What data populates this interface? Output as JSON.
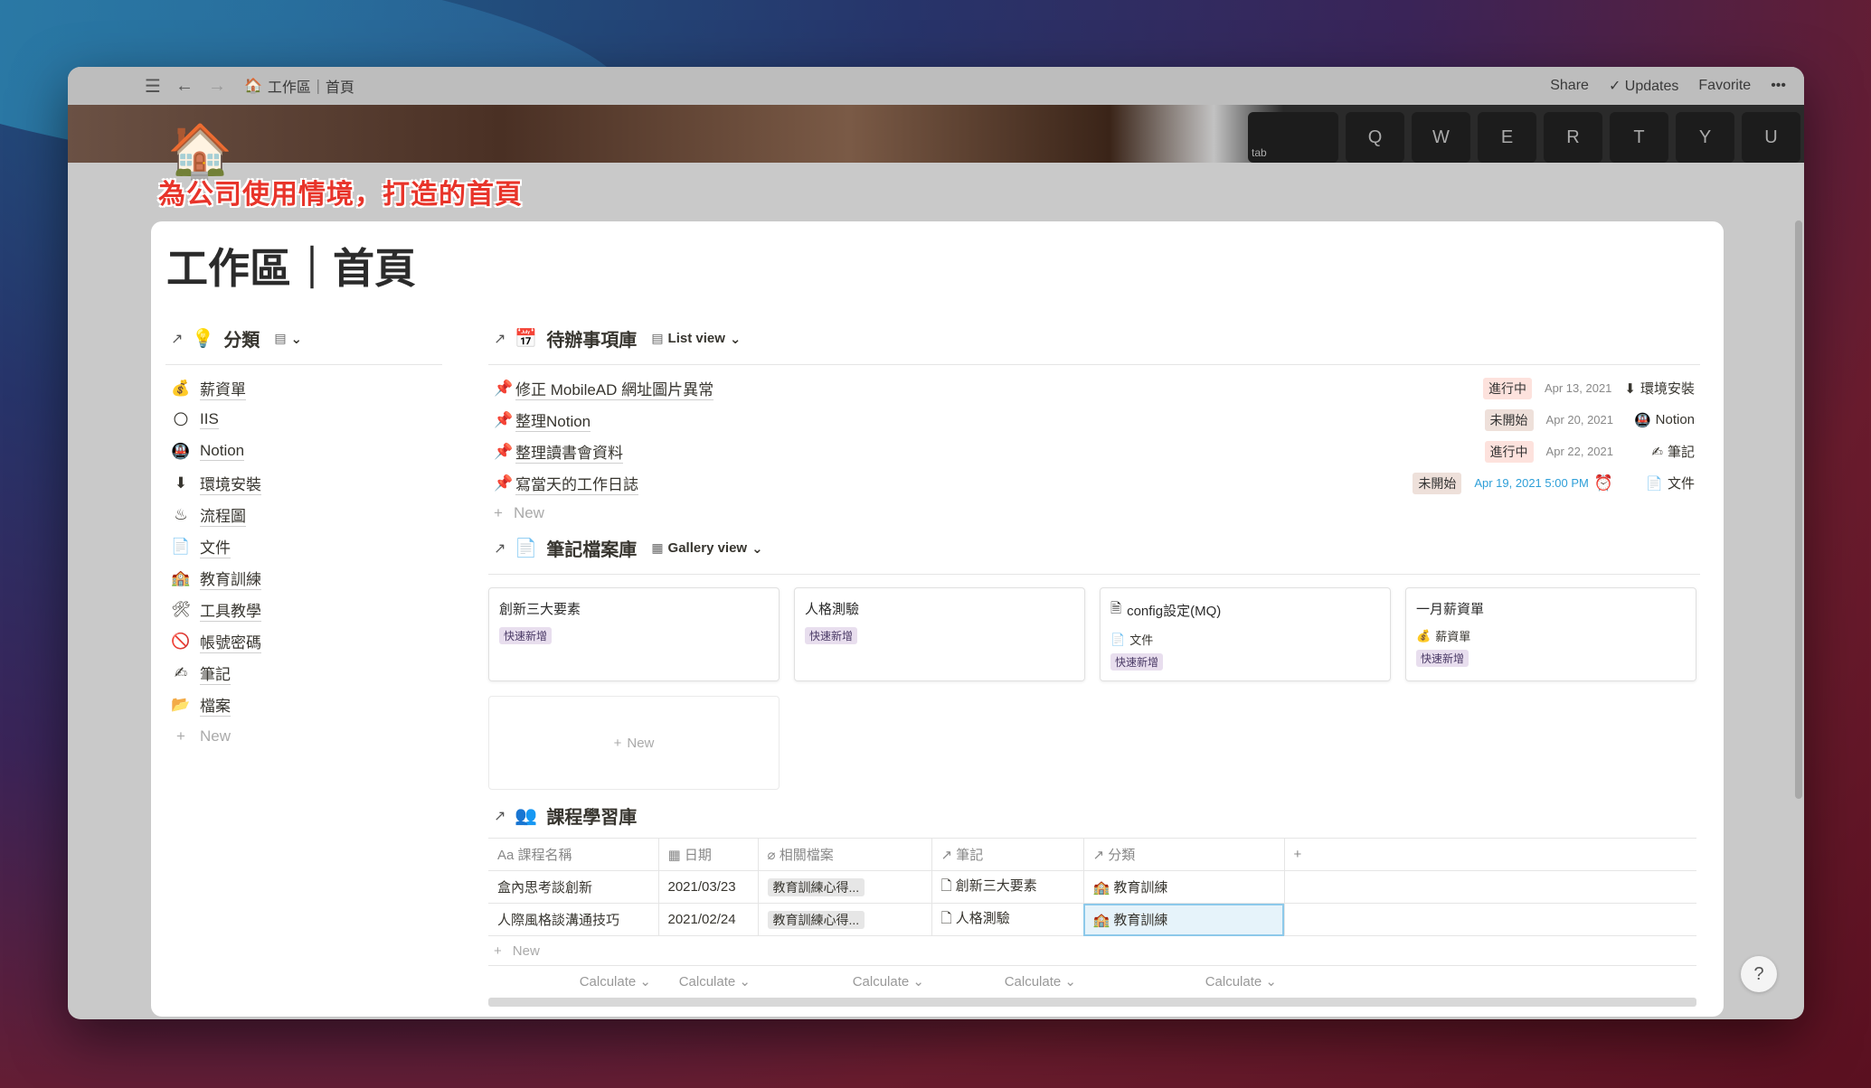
{
  "topbar": {
    "breadcrumb_icon": "🏠",
    "breadcrumb": "工作區｜首頁",
    "share": "Share",
    "updates": "Updates",
    "favorite": "Favorite",
    "more": "•••"
  },
  "cover": {
    "keys": [
      "Q",
      "W",
      "E",
      "R",
      "T",
      "Y",
      "U"
    ],
    "tab_key": "tab"
  },
  "page": {
    "icon": "🏠",
    "banner": "為公司使用情境，打造的首頁",
    "title": "工作區｜首頁"
  },
  "categories": {
    "icon": "💡",
    "title": "分類",
    "items": [
      {
        "icon": "💰",
        "label": "薪資單"
      },
      {
        "icon": "🌕",
        "label": "IIS"
      },
      {
        "icon": "🚇",
        "label": "Notion"
      },
      {
        "icon": "⬇",
        "label": "環境安裝"
      },
      {
        "icon": "♨",
        "label": "流程圖"
      },
      {
        "icon": "📄",
        "label": "文件"
      },
      {
        "icon": "🏫",
        "label": "教育訓練"
      },
      {
        "icon": "🛠",
        "label": "工具教學"
      },
      {
        "icon": "🚫",
        "label": "帳號密碼"
      },
      {
        "icon": "✍",
        "label": "筆記"
      },
      {
        "icon": "📂",
        "label": "檔案"
      }
    ],
    "new": "New"
  },
  "todos": {
    "icon": "📅",
    "title": "待辦事項庫",
    "view": "List view",
    "items": [
      {
        "name": "修正 MobileAD 網址圖片異常",
        "status": "進行中",
        "date": "Apr 13, 2021",
        "rel_icon": "⬇",
        "rel": "環境安裝"
      },
      {
        "name": "整理Notion",
        "status": "未開始",
        "date": "Apr 20, 2021",
        "rel_icon": "🚇",
        "rel": "Notion"
      },
      {
        "name": "整理讀書會資料",
        "status": "進行中",
        "date": "Apr 22, 2021",
        "rel_icon": "✍",
        "rel": "筆記"
      },
      {
        "name": "寫當天的工作日誌",
        "status": "未開始",
        "date": "Apr 19, 2021 5:00 PM",
        "rel_icon": "📄",
        "rel": "文件"
      }
    ],
    "new": "New"
  },
  "notes": {
    "icon": "📄",
    "title": "筆記檔案庫",
    "view": "Gallery view",
    "cards": [
      {
        "title": "創新三大要素",
        "tag": "快速新增"
      },
      {
        "title": "人格測驗",
        "tag": "快速新增"
      },
      {
        "title": "config設定(MQ)",
        "rel": "文件",
        "tag": "快速新增"
      },
      {
        "title": "一月薪資單",
        "rel": "薪資單",
        "tag": "快速新增"
      }
    ],
    "new": "New"
  },
  "courses": {
    "icon": "👥",
    "title": "課程學習庫",
    "columns": [
      "課程名稱",
      "日期",
      "相關檔案",
      "筆記",
      "分類"
    ],
    "rows": [
      {
        "name": "盒內思考談創新",
        "date": "2021/03/23",
        "file": "教育訓練心得...",
        "note": "創新三大要素",
        "cat": "教育訓練"
      },
      {
        "name": "人際風格談溝通技巧",
        "date": "2021/02/24",
        "file": "教育訓練心得...",
        "note": "人格測驗",
        "cat": "教育訓練"
      }
    ],
    "new": "New",
    "calc": "Calculate"
  },
  "help": "?"
}
